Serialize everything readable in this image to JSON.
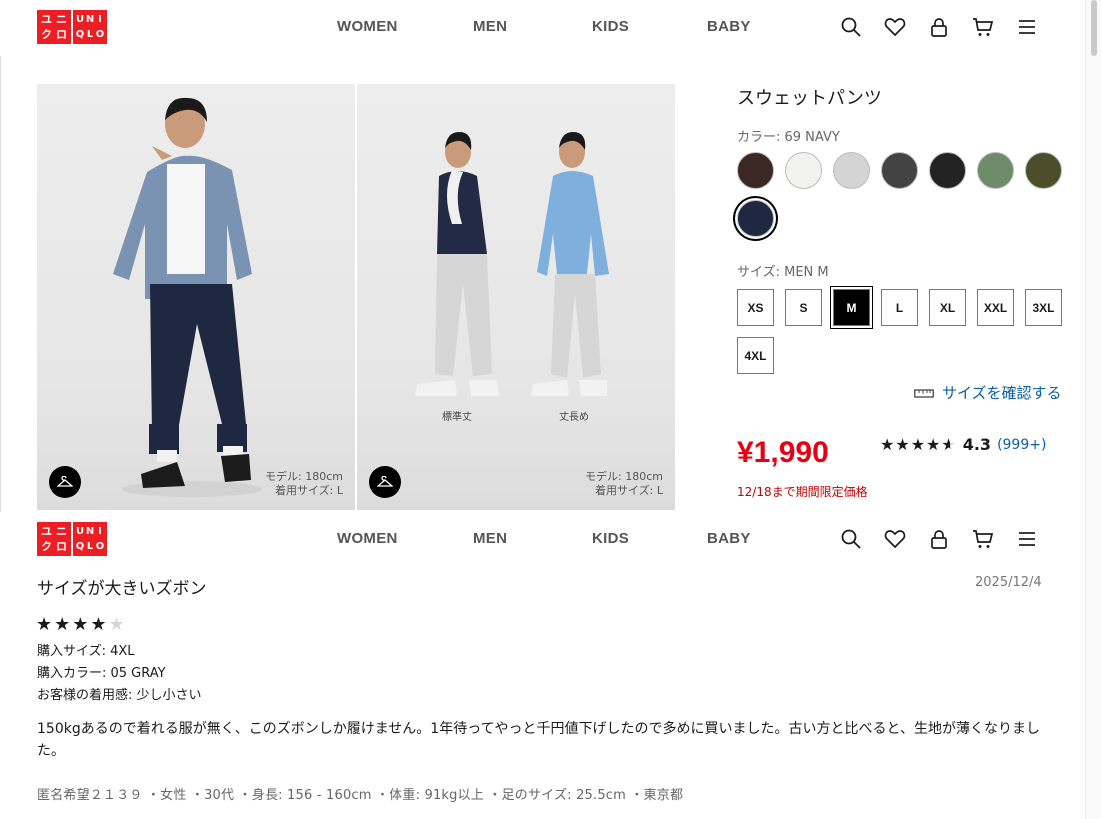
{
  "brand": {
    "logo_left": [
      "ユ",
      "ニ",
      "ク",
      "ロ"
    ],
    "logo_right": [
      "U",
      "N",
      "I",
      "Q",
      "L",
      "O"
    ],
    "color": "#ed1d24"
  },
  "nav": {
    "items": [
      "WOMEN",
      "MEN",
      "KIDS",
      "BABY"
    ],
    "icons": [
      "search-icon",
      "heart-icon",
      "account-icon",
      "cart-icon",
      "menu-icon"
    ]
  },
  "gallery": {
    "image1": {
      "model_note_1": "モデル: 180cm",
      "model_note_2": "着用サイズ: L"
    },
    "image2": {
      "caption_a": "標準丈",
      "caption_b": "丈長め",
      "model_note_1": "モデル: 180cm",
      "model_note_2": "着用サイズ: L"
    }
  },
  "product": {
    "title": "スウェットパンツ",
    "color_label": "カラー: 69 NAVY",
    "swatches": [
      {
        "name": "brown",
        "hex": "#3b2723"
      },
      {
        "name": "off-white",
        "hex": "#f2f2f0"
      },
      {
        "name": "light-gray",
        "hex": "#d4d4d4"
      },
      {
        "name": "dark-gray",
        "hex": "#434343"
      },
      {
        "name": "black",
        "hex": "#232323"
      },
      {
        "name": "green",
        "hex": "#6f8c6a"
      },
      {
        "name": "olive",
        "hex": "#4c4e2a"
      },
      {
        "name": "navy",
        "hex": "#1e2840",
        "selected": true
      }
    ],
    "size_label": "サイズ: MEN M",
    "sizes": [
      "XS",
      "S",
      "M",
      "L",
      "XL",
      "XXL",
      "3XL",
      "4XL"
    ],
    "selected_size": "M",
    "size_check_link": "サイズを確認する",
    "price": "¥1,990",
    "promo": "12/18まで期間限定価格",
    "rating": {
      "stars": 4.5,
      "score": "4.3",
      "count": "(999+)"
    },
    "accent_price": "#e60012",
    "link_color": "#0b5fa5"
  },
  "review": {
    "title": "サイズが大きいズボン",
    "date": "2025/12/4",
    "stars": 4,
    "purchase_size": "購入サイズ: 4XL",
    "purchase_color": "購入カラー: 05 GRAY",
    "fit": "お客様の着用感: 少し小さい",
    "body": "150kgあるので着れる服が無く、このズボンしか履けません。1年待ってやっと千円値下げしたので多めに買いました。古い方と比べると、生地が薄くなりました。",
    "author": "匿名希望２１３９ ・女性 ・30代 ・身長: 156 - 160cm ・体重: 91kg以上 ・足のサイズ: 25.5cm ・東京都"
  }
}
